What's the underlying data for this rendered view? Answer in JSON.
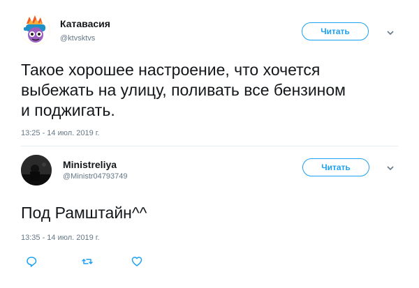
{
  "tweet1": {
    "name": "Катавасия",
    "handle": "@ktvsktvs",
    "follow_label": "Читать",
    "text_lines": [
      "Такое хорошее настроение, что хочется",
      "выбежать на улицу, поливать все бензином",
      "и поджигать."
    ],
    "timestamp": "13:25 - 14 июл. 2019 г."
  },
  "tweet2": {
    "name": "Ministreliya",
    "handle": "@Ministr04793749",
    "follow_label": "Читать",
    "text": "Под Рамштайн^^",
    "timestamp": "13:35 - 14 июл. 2019 г."
  },
  "actions": {
    "icons": [
      "reply-icon",
      "retweet-icon",
      "like-icon"
    ]
  },
  "colors": {
    "accent": "#1da1f2",
    "secondary_text": "#657786",
    "primary_text": "#14171a"
  }
}
